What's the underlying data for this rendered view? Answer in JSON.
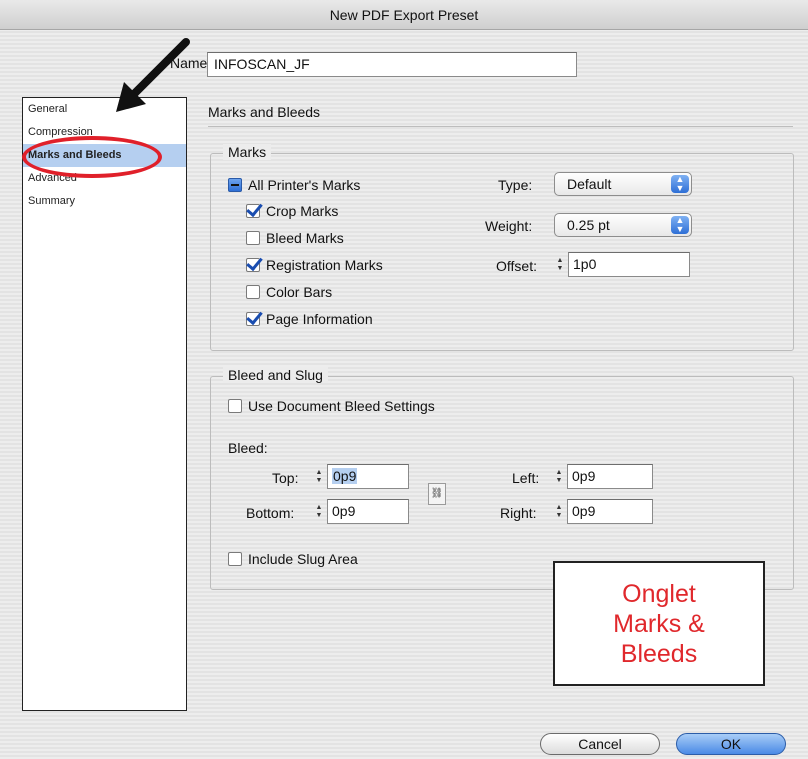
{
  "window": {
    "title": "New PDF Export Preset"
  },
  "name": {
    "label": "Name:",
    "value": "INFOSCAN_JF"
  },
  "sidebar": {
    "items": [
      {
        "label": "General",
        "selected": false
      },
      {
        "label": "Compression",
        "selected": false
      },
      {
        "label": "Marks and Bleeds",
        "selected": true
      },
      {
        "label": "Advanced",
        "selected": false
      },
      {
        "label": "Summary",
        "selected": false
      }
    ]
  },
  "panel": {
    "title": "Marks and Bleeds"
  },
  "marks": {
    "group_label": "Marks",
    "all_printers_marks": {
      "label": "All Printer's Marks",
      "state": "mixed"
    },
    "crop_marks": {
      "label": "Crop Marks",
      "checked": true
    },
    "bleed_marks": {
      "label": "Bleed Marks",
      "checked": false
    },
    "registration_marks": {
      "label": "Registration Marks",
      "checked": true
    },
    "color_bars": {
      "label": "Color Bars",
      "checked": false
    },
    "page_information": {
      "label": "Page Information",
      "checked": true
    },
    "type": {
      "label": "Type:",
      "value": "Default"
    },
    "weight": {
      "label": "Weight:",
      "value": "0.25 pt"
    },
    "offset": {
      "label": "Offset:",
      "value": "1p0"
    }
  },
  "bleed_slug": {
    "group_label": "Bleed and Slug",
    "use_document_bleed": {
      "label": "Use Document Bleed Settings",
      "checked": false
    },
    "bleed_label": "Bleed:",
    "top": {
      "label": "Top:",
      "value": "0p9"
    },
    "bottom": {
      "label": "Bottom:",
      "value": "0p9"
    },
    "left": {
      "label": "Left:",
      "value": "0p9"
    },
    "right": {
      "label": "Right:",
      "value": "0p9"
    },
    "include_slug": {
      "label": "Include Slug Area",
      "checked": false
    }
  },
  "annotation": {
    "lines": [
      "Onglet",
      "Marks &",
      "Bleeds"
    ],
    "text_color": "#e0282c",
    "highlight_color": "#e0202a"
  },
  "buttons": {
    "cancel": "Cancel",
    "ok": "OK"
  },
  "colors": {
    "selection": "#b5cff0",
    "accent_blue": "#2e6fd6"
  }
}
